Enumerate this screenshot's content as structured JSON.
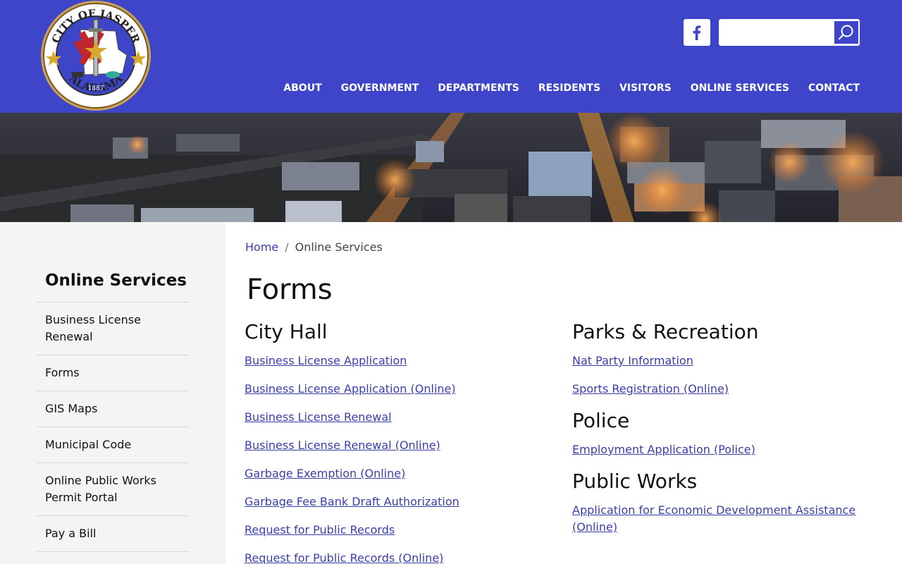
{
  "header": {
    "seal": {
      "top_text": "CITY OF JASPER",
      "bottom_text": "ALABAMA",
      "year": "1887"
    },
    "search": {
      "placeholder": ""
    },
    "nav": [
      {
        "label": "ABOUT"
      },
      {
        "label": "GOVERNMENT"
      },
      {
        "label": "DEPARTMENTS"
      },
      {
        "label": "RESIDENTS"
      },
      {
        "label": "VISITORS"
      },
      {
        "label": "ONLINE SERVICES"
      },
      {
        "label": "CONTACT"
      }
    ],
    "colors": {
      "brand": "#3f45c9"
    }
  },
  "sidebar": {
    "title": "Online Services",
    "items": [
      {
        "label": "Business License Renewal"
      },
      {
        "label": "Forms"
      },
      {
        "label": "GIS Maps"
      },
      {
        "label": "Municipal Code"
      },
      {
        "label": "Online Public Works Permit Portal"
      },
      {
        "label": "Pay a Bill"
      }
    ]
  },
  "breadcrumb": {
    "home": "Home",
    "separator": "/",
    "current": "Online Services"
  },
  "main": {
    "title": "Forms",
    "city_hall": {
      "heading": "City Hall",
      "links": [
        "Business License Application",
        "Business License Application (Online)",
        "Business License Renewal",
        "Business License Renewal (Online)",
        "Garbage Exemption (Online)",
        "Garbage Fee Bank Draft Authorization",
        "Request for Public Records",
        "Request for Public Records (Online)"
      ]
    },
    "parks": {
      "heading": "Parks & Recreation",
      "links": [
        "Nat Party Information",
        "Sports Registration (Online)"
      ]
    },
    "police": {
      "heading": "Police",
      "links": [
        "Employment Application (Police)"
      ]
    },
    "public_works": {
      "heading": "Public Works",
      "links": [
        "Application for Economic Development Assistance (Online)"
      ]
    },
    "colors": {
      "link": "#3a3fa8"
    }
  }
}
